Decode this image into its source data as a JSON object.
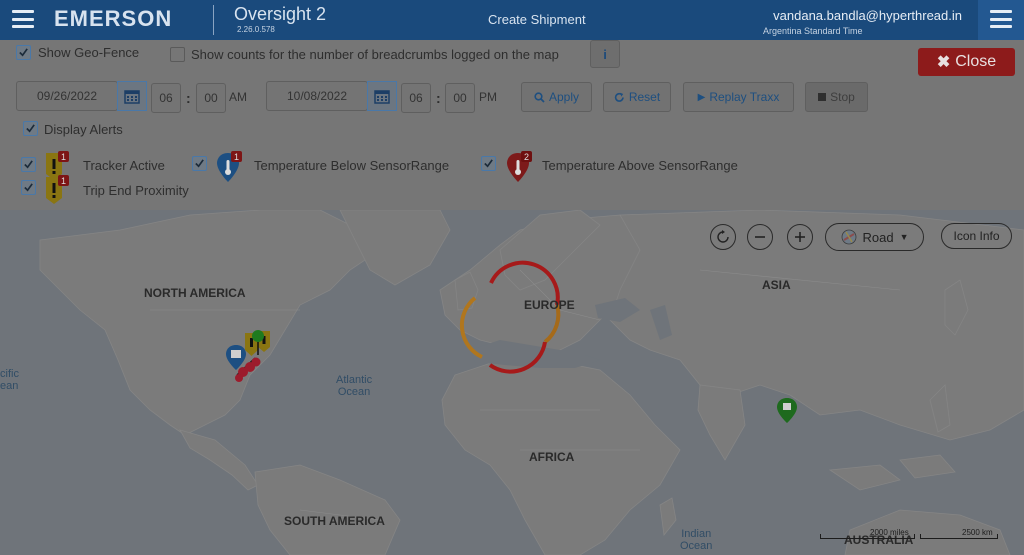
{
  "header": {
    "brand": "EMERSON",
    "app_title": "Oversight 2",
    "app_version": "2.26.0.578",
    "create_shipment": "Create Shipment",
    "user_email": "vandana.bandla@hyperthread.in",
    "user_timezone": "Argentina Standard Time"
  },
  "filters": {
    "show_geofence": {
      "label": "Show Geo-Fence",
      "checked": true
    },
    "show_counts": {
      "label": "Show counts for the number of breadcrumbs logged on the map",
      "checked": false
    },
    "info_button": "i",
    "close_button": "Close",
    "start_date": "09/26/2022",
    "start_hour": "06",
    "start_minute": "00",
    "start_ampm": "AM",
    "end_date": "10/08/2022",
    "end_hour": "06",
    "end_minute": "00",
    "end_ampm": "PM",
    "apply_button": "Apply",
    "reset_button": "Reset",
    "replay_button": "Replay Traxx",
    "stop_button": "Stop",
    "display_alerts": {
      "label": "Display Alerts",
      "checked": true
    },
    "alerts": [
      {
        "label": "Tracker Active",
        "checked": true,
        "icon": "tracker-active-icon",
        "badge": "1"
      },
      {
        "label": "Temperature Below SensorRange",
        "checked": true,
        "icon": "temperature-below-icon",
        "badge": "1"
      },
      {
        "label": "Temperature Above SensorRange",
        "checked": true,
        "icon": "temperature-above-icon",
        "badge": "2"
      },
      {
        "label": "Trip End Proximity",
        "checked": true,
        "icon": "trip-end-proximity-icon",
        "badge": "1"
      }
    ]
  },
  "map": {
    "road_button": "Road",
    "icon_info_button": "Icon Info",
    "labels": {
      "north_america": "NORTH AMERICA",
      "europe": "EUROPE",
      "asia": "ASIA",
      "africa": "AFRICA",
      "south_america": "SOUTH AMERICA",
      "australia": "AUSTRALIA",
      "pacific_ocean": "cific\nean",
      "atlantic_ocean": "Atlantic\nOcean",
      "indian_ocean": "Indian\nOcean"
    },
    "scale_miles": "2000 miles",
    "scale_km": "2500 km"
  },
  "colors": {
    "header_bg": "#1a4a7c",
    "close_bg": "#8d1b1b",
    "accent": "#1e4f80",
    "alert_red": "#b22222",
    "pin_yellow": "#c7a500",
    "pin_green": "#1e7a1e"
  }
}
